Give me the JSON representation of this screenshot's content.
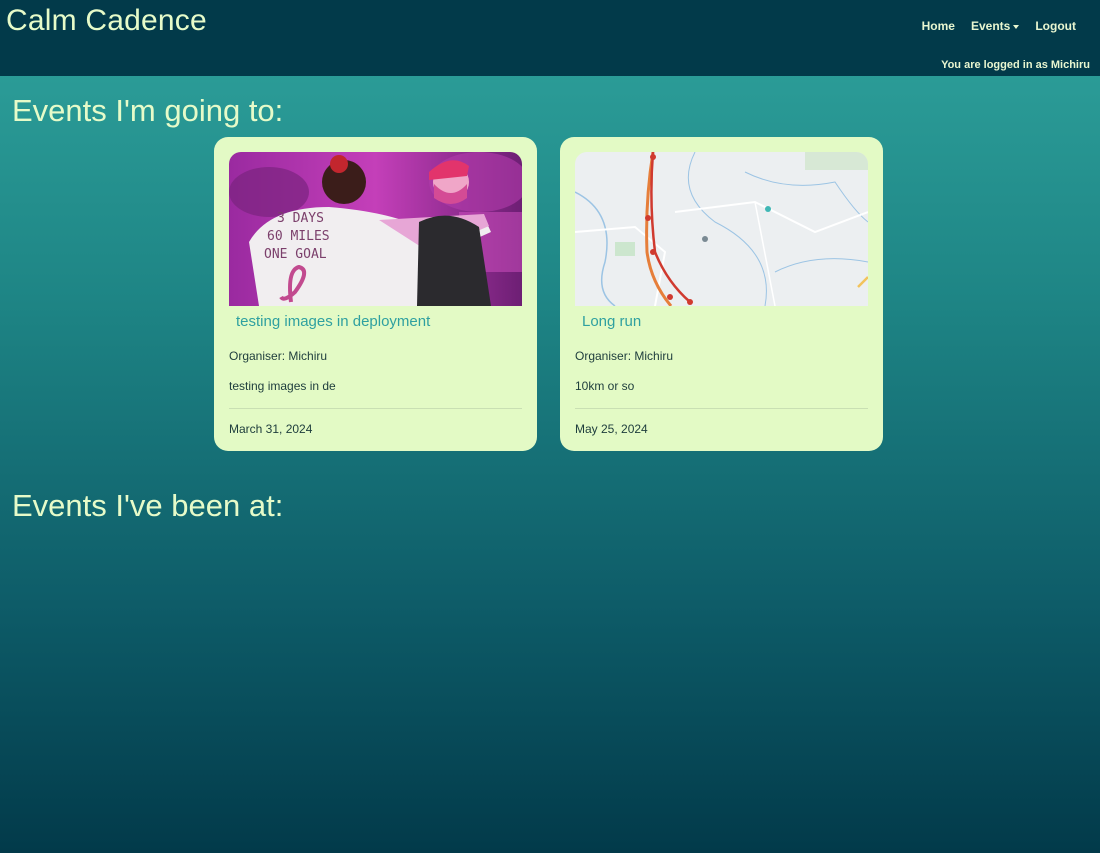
{
  "navbar": {
    "brand": "Calm Cadence",
    "links": [
      {
        "label": "Home"
      },
      {
        "label": "Events"
      },
      {
        "label": "Logout"
      }
    ],
    "login_status": "You are logged in as Michiru"
  },
  "sections": {
    "going_heading": "Events I'm going to:",
    "been_heading": "Events I've been at:"
  },
  "events_going": [
    {
      "title": "testing images in deployment",
      "organiser": "Organiser: Michiru",
      "description": "testing images in de",
      "date": "March 31, 2024",
      "image": "photo of charity walk participants in pink shirts"
    },
    {
      "title": "Long run",
      "organiser": "Organiser: Michiru",
      "description": "10km or so",
      "date": "May 25, 2024",
      "image": "map screenshot of running route"
    }
  ],
  "events_been": [],
  "colors": {
    "navbar_bg": "#023a4a",
    "card_bg": "#e3fac5",
    "accent_title": "#2fa0a0",
    "heading_text": "#e6fbc9"
  }
}
